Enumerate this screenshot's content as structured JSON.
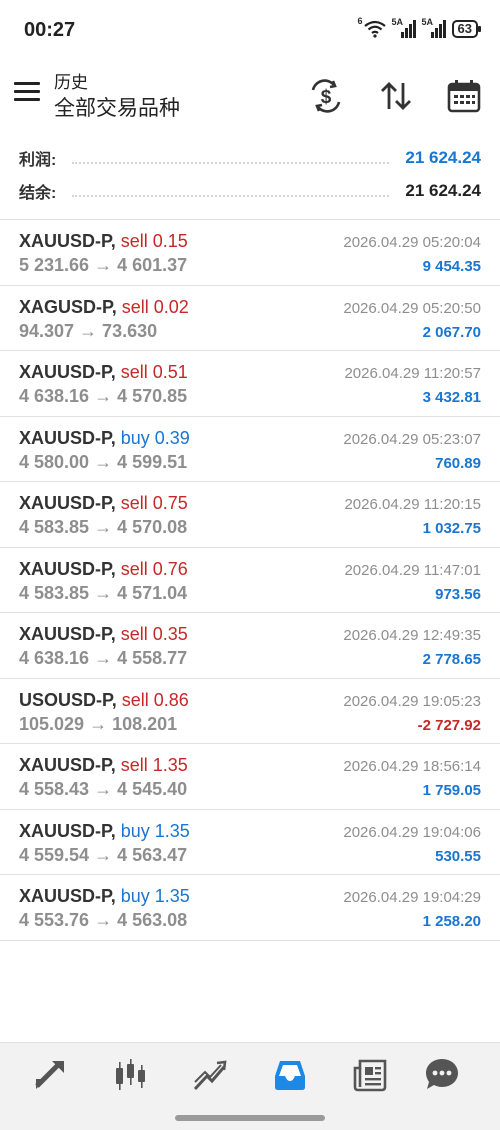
{
  "status_bar": {
    "time": "00:27",
    "wifi_label": "6",
    "signal1_label": "5A",
    "signal2_label": "5A",
    "battery": "63"
  },
  "header": {
    "small_title": "历史",
    "main_title": "全部交易品种",
    "icons": [
      "currency-exchange-icon",
      "sort-icon",
      "calendar-icon"
    ]
  },
  "summary": {
    "profit_label": "利润:",
    "profit_value": "21 624.24",
    "balance_label": "结余:",
    "balance_value": "21 624.24"
  },
  "colors": {
    "sell": "#c62828",
    "buy": "#1976d2",
    "positive": "#1976d2",
    "negative": "#c62828",
    "active_tab": "#1e88e5"
  },
  "trades": [
    {
      "symbol": "XAUUSD-P,",
      "side": "sell 0.15",
      "prices": "5 231.66 → 4 601.37",
      "time": "2026.04.29 05:20:04",
      "profit": "9 454.35"
    },
    {
      "symbol": "XAGUSD-P,",
      "side": "sell 0.02",
      "prices": "94.307 → 73.630",
      "time": "2026.04.29 05:20:50",
      "profit": "2 067.70"
    },
    {
      "symbol": "XAUUSD-P,",
      "side": "sell 0.51",
      "prices": "4 638.16 → 4 570.85",
      "time": "2026.04.29 11:20:57",
      "profit": "3 432.81"
    },
    {
      "symbol": "XAUUSD-P,",
      "side": "buy 0.39",
      "prices": "4 580.00 → 4 599.51",
      "time": "2026.04.29 05:23:07",
      "profit": "760.89"
    },
    {
      "symbol": "XAUUSD-P,",
      "side": "sell 0.75",
      "prices": "4 583.85 → 4 570.08",
      "time": "2026.04.29 11:20:15",
      "profit": "1 032.75"
    },
    {
      "symbol": "XAUUSD-P,",
      "side": "sell 0.76",
      "prices": "4 583.85 → 4 571.04",
      "time": "2026.04.29 11:47:01",
      "profit": "973.56"
    },
    {
      "symbol": "XAUUSD-P,",
      "side": "sell 0.35",
      "prices": "4 638.16 → 4 558.77",
      "time": "2026.04.29 12:49:35",
      "profit": "2 778.65"
    },
    {
      "symbol": "USOUSD-P,",
      "side": "sell 0.86",
      "prices": "105.029 → 108.201",
      "time": "2026.04.29 19:05:23",
      "profit": "-2 727.92"
    },
    {
      "symbol": "XAUUSD-P,",
      "side": "sell 1.35",
      "prices": "4 558.43 → 4 545.40",
      "time": "2026.04.29 18:56:14",
      "profit": "1 759.05"
    },
    {
      "symbol": "XAUUSD-P,",
      "side": "buy 1.35",
      "prices": "4 559.54 → 4 563.47",
      "time": "2026.04.29 19:04:06",
      "profit": "530.55"
    },
    {
      "symbol": "XAUUSD-P,",
      "side": "buy 1.35",
      "prices": "4 553.76 → 4 563.08",
      "time": "2026.04.29 19:04:29",
      "profit": "1 258.20"
    }
  ],
  "bottom_nav": [
    {
      "icon": "quotes-icon",
      "active": false
    },
    {
      "icon": "chart-icon",
      "active": false
    },
    {
      "icon": "trade-icon",
      "active": false
    },
    {
      "icon": "history-icon",
      "active": true
    },
    {
      "icon": "news-icon",
      "active": false
    },
    {
      "icon": "chat-icon",
      "active": false
    }
  ]
}
